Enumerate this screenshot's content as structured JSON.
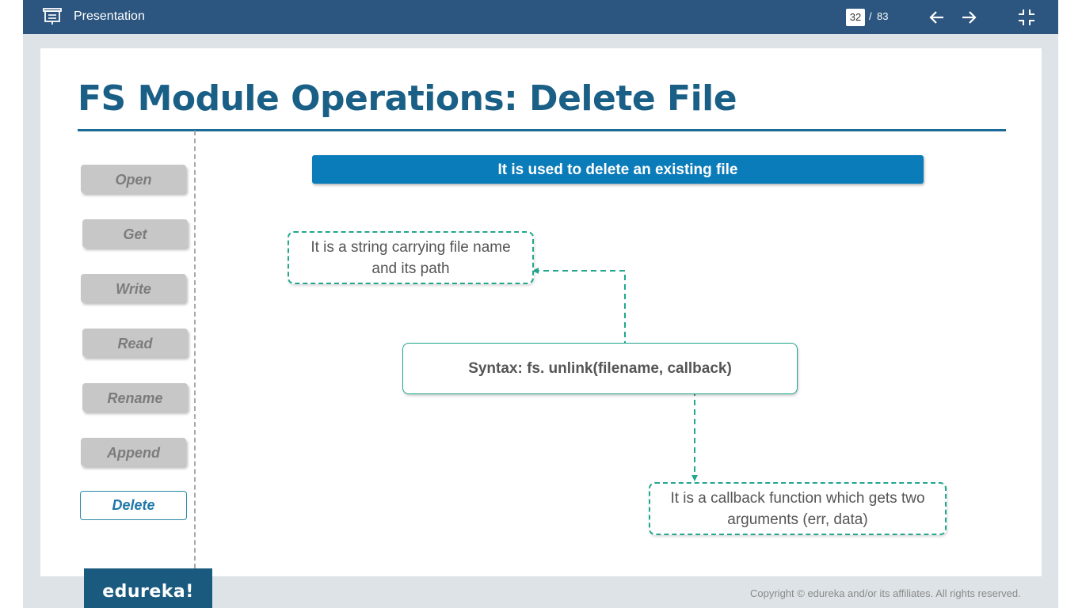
{
  "topbar": {
    "app_title": "Presentation",
    "current_page": "32",
    "page_separator": "/",
    "total_pages": "83",
    "icons": [
      "presentation-icon",
      "arrow-left-icon",
      "arrow-right-icon",
      "exit-fullscreen-icon"
    ]
  },
  "slide": {
    "title": "FS Module Operations: Delete File",
    "side_nav": [
      "Open",
      "Get",
      "Write",
      "Read",
      "Rename",
      "Append",
      "Delete"
    ],
    "active_item": "Delete",
    "banner": "It is used to delete an existing file",
    "callout_filename": "It is a string carrying file name and its path",
    "syntax": "Syntax: fs. unlink(filename, callback)",
    "callout_callback": "It is a callback function which gets two arguments (err, data)"
  },
  "footer": {
    "logo": "edureka!",
    "copyright": "Copyright © edureka and/or its affiliates. All rights reserved."
  },
  "colors": {
    "topbar": "#2c567f",
    "title": "#1a5f86",
    "banner": "#0b7cba",
    "teal_border": "#22a68d",
    "logo_bg": "#1a5a7e"
  }
}
